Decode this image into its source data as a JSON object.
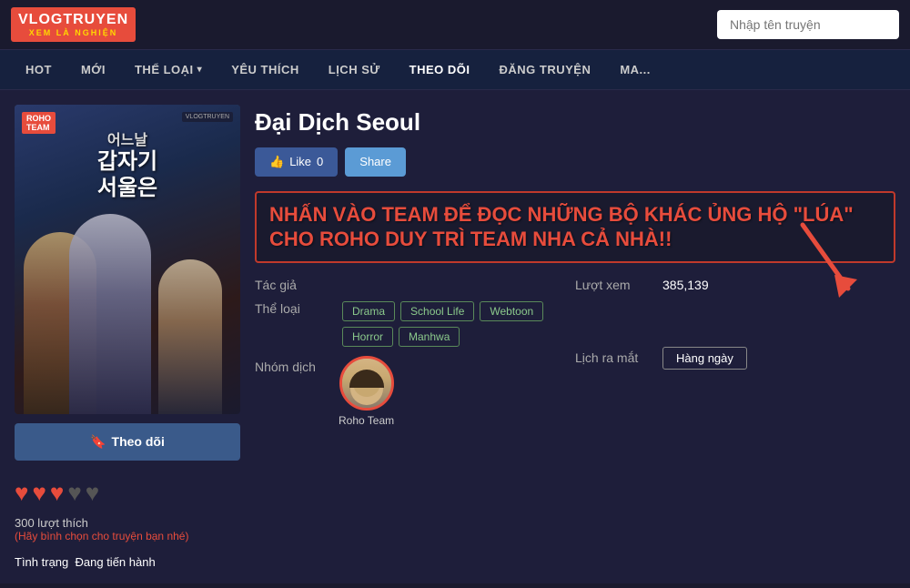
{
  "logo": {
    "main_text": "VLOGTRUYEN",
    "sub_text": "XEM LÀ NGHIỆN",
    "search_placeholder": "Nhập tên truyện"
  },
  "nav": {
    "items": [
      {
        "id": "hot",
        "label": "HOT"
      },
      {
        "id": "moi",
        "label": "MỚI"
      },
      {
        "id": "the-loai",
        "label": "THỂ LOẠI",
        "has_dropdown": true
      },
      {
        "id": "yeu-thich",
        "label": "YÊU THÍCH"
      },
      {
        "id": "lich-su",
        "label": "LỊCH SỬ"
      },
      {
        "id": "theo-doi",
        "label": "THEO DÕI"
      },
      {
        "id": "dang-truyen",
        "label": "ĐĂNG TRUYỆN"
      },
      {
        "id": "ma",
        "label": "MA..."
      }
    ]
  },
  "manga": {
    "title": "Đại Dịch Seoul",
    "cover": {
      "roho_badge": "ROHO\nTEAM",
      "vlog_badge": "VLOGTRUYEN",
      "title_lines": [
        "어느날",
        "갑자기",
        "서울은"
      ]
    },
    "like_label": "Like",
    "like_count": "0",
    "share_label": "Share",
    "promo_text": "NHẤN VÀO TEAM ĐỂ ĐỌC NHỮNG BỘ KHÁC ỦNG HỘ \"LÚA\" CHO ROHO DUY TRÌ TEAM NHA CẢ NHÀ!!",
    "info": {
      "author_label": "Tác giả",
      "author_value": "",
      "views_label": "Lượt xem",
      "views_value": "385,139",
      "genre_label": "Thể loại",
      "genres": [
        "Drama",
        "School Life",
        "Webtoon",
        "Horror",
        "Manhwa"
      ],
      "group_label": "Nhóm dịch",
      "translator_name": "Roho Team",
      "schedule_label": "Lịch ra mắt",
      "schedule_value": "Hàng ngày"
    },
    "follow_label": "Theo dõi",
    "hearts": 3,
    "max_hearts": 5,
    "rating_count": "300 lượt thích",
    "rating_prompt": "(Hãy bình chọn cho truyện bạn nhé)",
    "status_label": "Tình trạng",
    "status_value": "Đang tiến hành"
  }
}
